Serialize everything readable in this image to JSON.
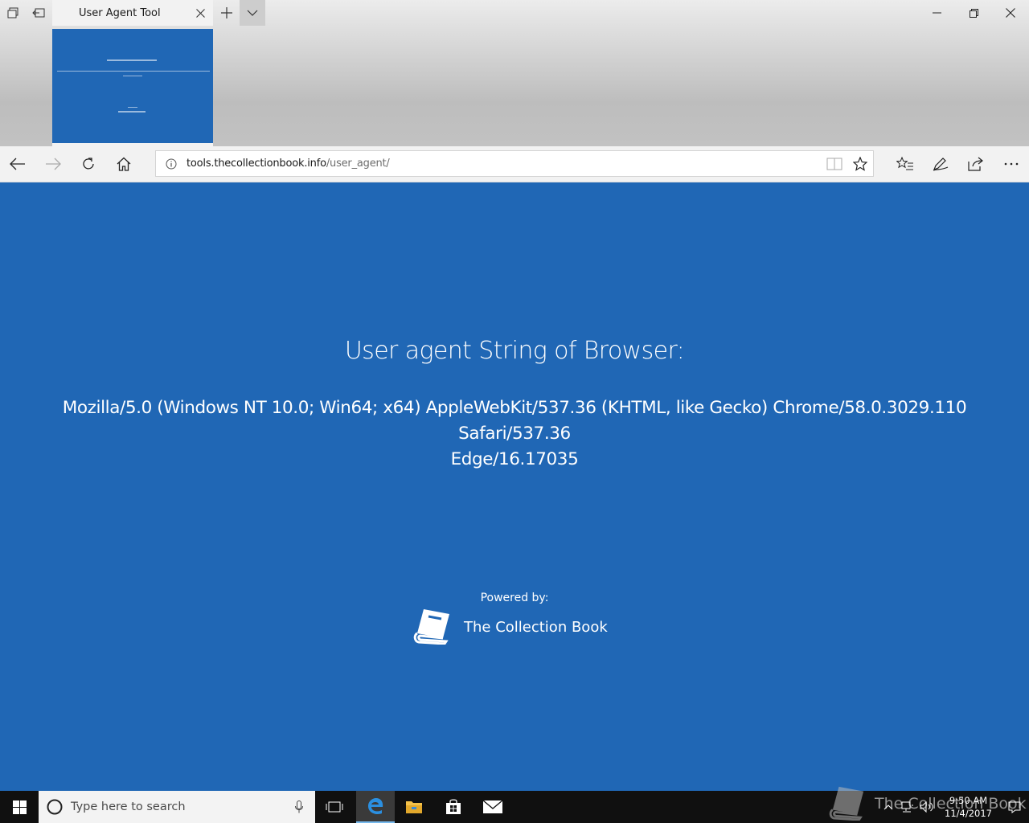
{
  "tab": {
    "title": "User Agent Tool"
  },
  "address_bar": {
    "domain": "tools.thecollectionbook.info",
    "path": "/user_agent/"
  },
  "page": {
    "heading": "User agent String of Browser:",
    "user_agent_line1": "Mozilla/5.0 (Windows NT 10.0; Win64; x64) AppleWebKit/537.36 (KHTML, like Gecko) Chrome/58.0.3029.110 Safari/537.36",
    "user_agent_line2": "Edge/16.17035",
    "powered_by": "Powered by:",
    "brand_name": "The Collection Book"
  },
  "taskbar": {
    "search_placeholder": "Type here to search",
    "time": "9:50 AM",
    "date": "11/4/2017"
  },
  "watermark": {
    "text": "The Collection Book"
  },
  "colors": {
    "page_background": "#2067b5",
    "taskbar": "#101010",
    "tab_strip": "#c9c9c9"
  },
  "icons": [
    "tab-set-aside-icon",
    "tabs-aside-icon",
    "close-icon",
    "plus-icon",
    "chevron-down-icon",
    "minimize-icon",
    "restore-icon",
    "back-icon",
    "forward-icon",
    "refresh-icon",
    "home-icon",
    "info-icon",
    "reading-view-icon",
    "star-icon",
    "favorites-icon",
    "pen-icon",
    "share-icon",
    "more-icon",
    "book-icon",
    "windows-logo-icon",
    "cortana-icon",
    "microphone-icon",
    "task-view-icon",
    "edge-icon",
    "folder-icon",
    "store-icon",
    "mail-icon",
    "chevron-up-icon",
    "network-icon",
    "volume-icon",
    "notification-icon"
  ]
}
